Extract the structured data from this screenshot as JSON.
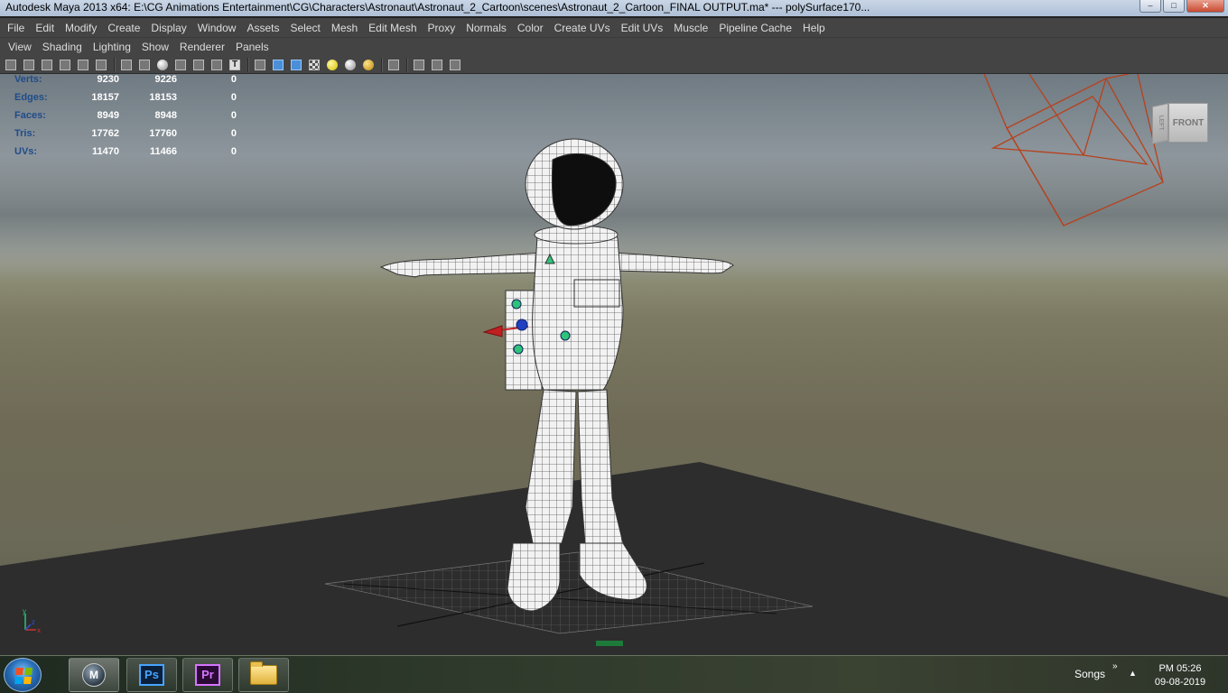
{
  "window": {
    "title": "Autodesk Maya 2013 x64: E:\\CG Animations Entertainment\\CG\\Characters\\Astronaut\\Astronaut_2_Cartoon\\scenes\\Astronaut_2_Cartoon_FINAL OUTPUT.ma*   ---   polySurface170...",
    "minimize": "–",
    "maximize": "□",
    "close": "✕"
  },
  "menu": [
    "File",
    "Edit",
    "Modify",
    "Create",
    "Display",
    "Window",
    "Assets",
    "Select",
    "Mesh",
    "Edit Mesh",
    "Proxy",
    "Normals",
    "Color",
    "Create UVs",
    "Edit UVs",
    "Muscle",
    "Pipeline Cache",
    "Help"
  ],
  "panel_menu": [
    "View",
    "Shading",
    "Lighting",
    "Show",
    "Renderer",
    "Panels"
  ],
  "toolbar_icons": [
    "select-camera-icon",
    "lock-camera-icon",
    "bookmarks-icon",
    "image-plane-icon",
    "grid-toggle-icon",
    "film-gate-icon",
    "wireframe-icon",
    "resolution-gate-icon",
    "smooth-shade-icon",
    "flat-shade-icon",
    "xray-icon",
    "xray-joints-icon",
    "textured-icon",
    "use-default-material-icon",
    "shadows-icon",
    "bounding-box-icon",
    "wireframe-on-shaded-icon",
    "shaded-icon",
    "checker-icon",
    "default-light-icon",
    "all-lights-icon",
    "high-quality-icon",
    "isolate-select-icon",
    "cube-icon",
    "two-pane-icon",
    "share-icon"
  ],
  "hud": {
    "rows": [
      {
        "label": "Verts:",
        "v1": "9230",
        "v2": "9226",
        "v3": "0"
      },
      {
        "label": "Edges:",
        "v1": "18157",
        "v2": "18153",
        "v3": "0"
      },
      {
        "label": "Faces:",
        "v1": "8949",
        "v2": "8948",
        "v3": "0"
      },
      {
        "label": "Tris:",
        "v1": "17762",
        "v2": "17760",
        "v3": "0"
      },
      {
        "label": "UVs:",
        "v1": "11470",
        "v2": "11466",
        "v3": "0"
      }
    ]
  },
  "viewcube": {
    "front": "FRONT",
    "left": "LEFT"
  },
  "axis": {
    "y": "y",
    "x": "x",
    "z": "z"
  },
  "taskbar": {
    "apps": [
      {
        "name": "maya",
        "label": "M"
      },
      {
        "name": "photoshop",
        "label": "Ps"
      },
      {
        "name": "premiere",
        "label": "Pr"
      },
      {
        "name": "explorer",
        "label": ""
      }
    ],
    "toolbar_name": "Songs",
    "chevron": "»",
    "tray_arrow": "▲",
    "time": "PM 05:26",
    "date": "09-08-2019"
  },
  "colors": {
    "hud_label": "#1f4c8a",
    "maya_bg": "#444444",
    "grid_floor": "#2b2b2b",
    "camera_wire": "#c0401a"
  }
}
